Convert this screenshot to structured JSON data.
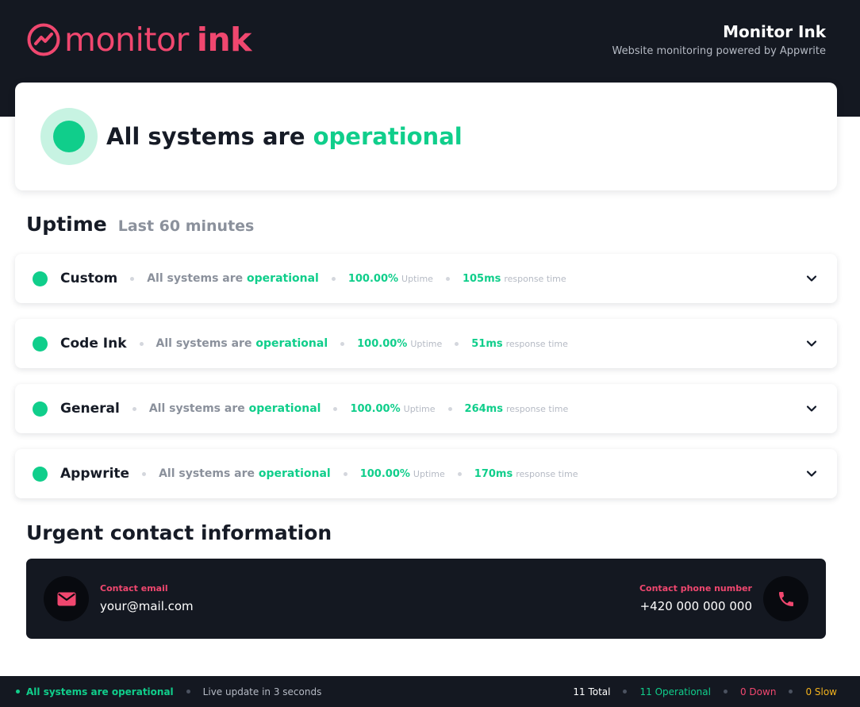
{
  "header": {
    "logo_word1": "monitor",
    "logo_word2": "ink",
    "title": "Monitor Ink",
    "subtitle": "Website monitoring powered by Appwrite",
    "logo_icon": "pulse-circle-icon"
  },
  "hero": {
    "status_prefix": "All systems are",
    "status_word": "operational"
  },
  "uptime": {
    "title": "Uptime",
    "subtitle": "Last 60 minutes",
    "services": [
      {
        "name": "Custom",
        "status_prefix": "All systems are",
        "status_word": "operational",
        "uptime_value": "100.00%",
        "uptime_label": "Uptime",
        "response_value": "105ms",
        "response_label": "response time"
      },
      {
        "name": "Code Ink",
        "status_prefix": "All systems are",
        "status_word": "operational",
        "uptime_value": "100.00%",
        "uptime_label": "Uptime",
        "response_value": "51ms",
        "response_label": "response time"
      },
      {
        "name": "General",
        "status_prefix": "All systems are",
        "status_word": "operational",
        "uptime_value": "100.00%",
        "uptime_label": "Uptime",
        "response_value": "264ms",
        "response_label": "response time"
      },
      {
        "name": "Appwrite",
        "status_prefix": "All systems are",
        "status_word": "operational",
        "uptime_value": "100.00%",
        "uptime_label": "Uptime",
        "response_value": "170ms",
        "response_label": "response time"
      }
    ]
  },
  "contact": {
    "title": "Urgent contact information",
    "email_label": "Contact email",
    "email_value": "your@mail.com",
    "phone_label": "Contact phone number",
    "phone_value": "+420 000 000 000",
    "email_icon": "mail-icon",
    "phone_icon": "phone-icon"
  },
  "footer": {
    "status": "All systems are operational",
    "live_update": "Live update in 3 seconds",
    "total": "11 Total",
    "operational": "11 Operational",
    "down": "0 Down",
    "slow": "0 Slow"
  },
  "colors": {
    "accent": "#f0476f",
    "operational": "#10ce8b",
    "slow": "#f2b21d",
    "dark": "#141821"
  }
}
